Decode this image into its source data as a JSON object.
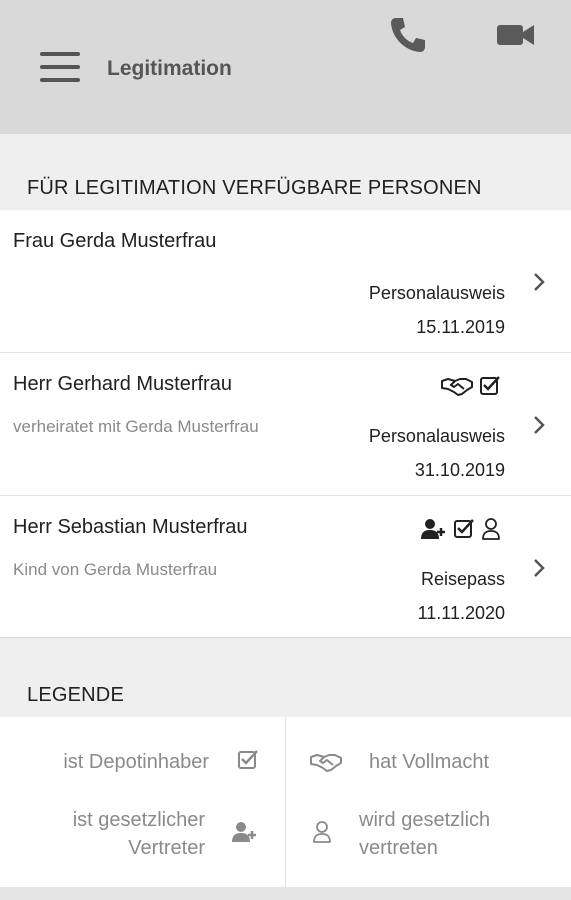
{
  "header": {
    "title": "Legitimation"
  },
  "section_persons": {
    "title": "FÜR LEGITIMATION VERFÜGBARE PERSONEN"
  },
  "persons": [
    {
      "name": "Frau Gerda Musterfrau",
      "relation": "",
      "document": "Personalausweis",
      "date": "15.11.2019",
      "icons": []
    },
    {
      "name": "Herr Gerhard Musterfrau",
      "relation": "verheiratet mit Gerda Musterfrau",
      "document": "Personalausweis",
      "date": "31.10.2019",
      "icons": [
        "handshake-icon",
        "checkbox-icon"
      ]
    },
    {
      "name": "Herr Sebastian Musterfrau",
      "relation": "Kind von Gerda Musterfrau",
      "document": "Reisepass",
      "date": "11.11.2020",
      "icons": [
        "user-plus-icon",
        "checkbox-icon",
        "person-outline-icon"
      ]
    }
  ],
  "section_legend": {
    "title": "LEGENDE"
  },
  "legend": {
    "depotinhaber": "ist Depotinhaber",
    "vollmacht": "hat Vollmacht",
    "vertreter_line1": "ist gesetzlicher",
    "vertreter_line2": "Vertreter",
    "vertreten_line1": "wird gesetzlich",
    "vertreten_line2": "vertreten"
  }
}
